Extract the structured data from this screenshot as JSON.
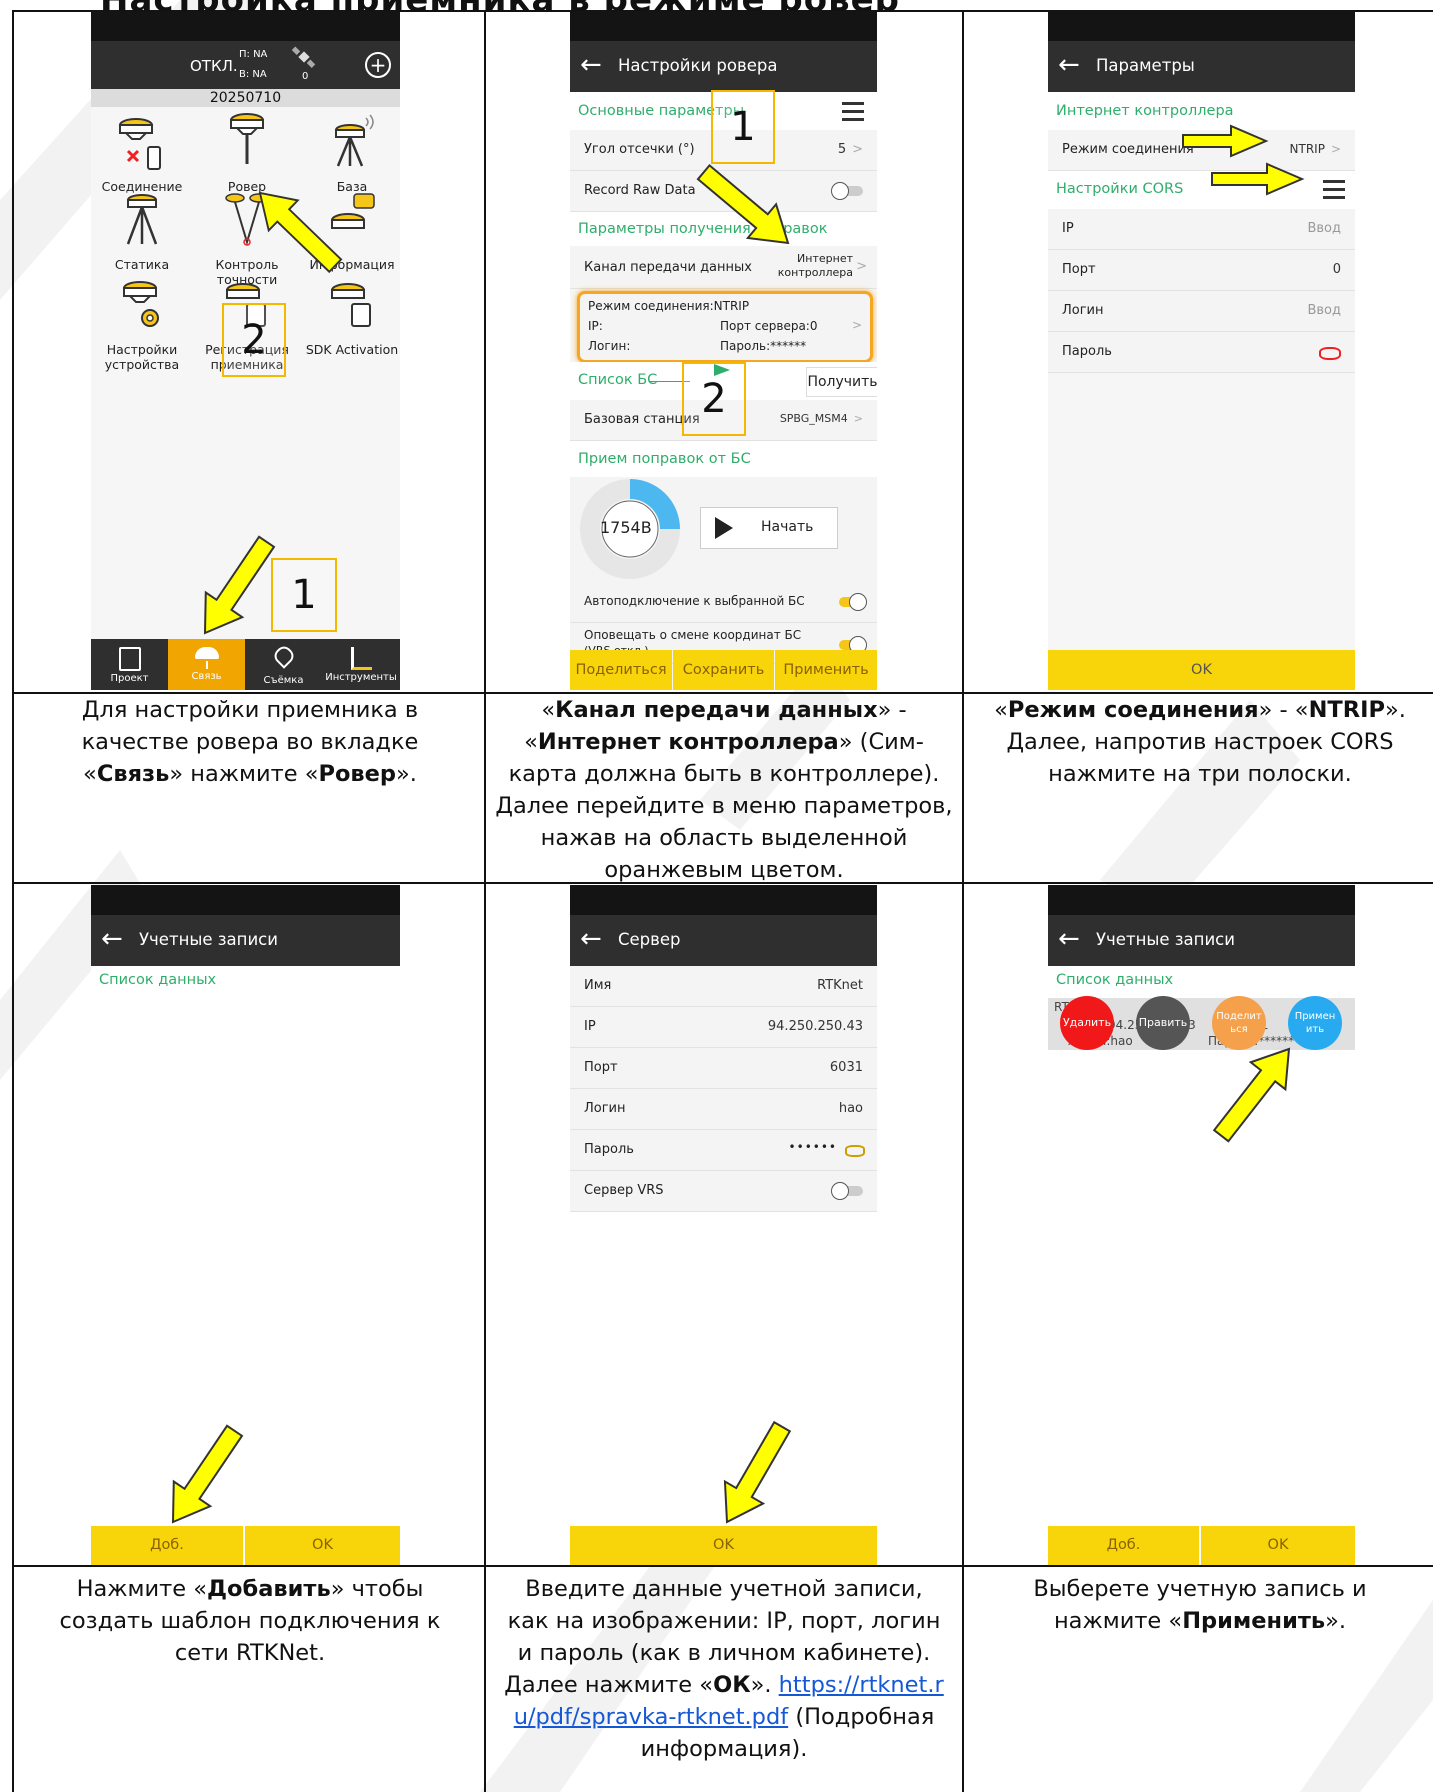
{
  "title": "Настройка приемника в режиме ровер",
  "colors": {
    "yellow": "#f8d40a",
    "green": "#2fae6b",
    "orange": "#f5a623",
    "appbar": "#2f2f2f",
    "link": "#1558d6"
  },
  "p1": {
    "status_label": "ОТКЛ.",
    "status_p": "П: NA",
    "status_b": "В: NA",
    "sat_count": "0",
    "date": "20250710",
    "tiles": [
      "Соединение",
      "Ровер",
      "База",
      "Статика",
      "Контроль точности",
      "Информация",
      "Настройки устройства",
      "Регистрация приемника",
      "SDK Activation"
    ],
    "nav": [
      "Проект",
      "Связь",
      "Съёмка",
      "Инструменты"
    ],
    "marker1": "1",
    "marker2": "2"
  },
  "p2": {
    "title": "Настройки ровера",
    "sect_basic": "Основные параметры",
    "cutoff_label": "Угол отсечки (°)",
    "cutoff_value": "5",
    "raw_label": "Record Raw Data",
    "sect_corr": "Параметры получения поправок",
    "channel_label": "Канал передачи данных",
    "channel_value": "Интернет контроллера",
    "mode_line": "Режим соединения:NTRIP",
    "ip_label": "IP:",
    "port_label": "Порт сервера:0",
    "login_label": "Логин:",
    "password_label": "Пароль:******",
    "bs_list": "Список БС",
    "get_button": "Получить",
    "base_label": "Базовая станция",
    "base_value": "SPBG_MSM4",
    "sect_recv": "Прием поправок от БС",
    "bytes": "1754B",
    "start_button": "Начать",
    "autoconnect": "Автоподключение к выбранной БС",
    "notify": "Оповещать о смене координат БС",
    "notify_sub": "(VRS откл.)",
    "share": "Поделиться",
    "save": "Сохранить",
    "apply": "Применить",
    "marker1": "1",
    "marker2": "2"
  },
  "p3": {
    "title": "Параметры",
    "sect_inet": "Интернет контроллера",
    "mode_label": "Режим соединения",
    "mode_value": "NTRIP",
    "sect_cors": "Настройки CORS",
    "ip_label": "IP",
    "ip_value": "Ввод",
    "port_label": "Порт",
    "port_value": "0",
    "login_label": "Логин",
    "login_value": "Ввод",
    "password_label": "Пароль",
    "ok": "OK"
  },
  "p4": {
    "title": "Учетные записи",
    "sect": "Список данных",
    "add": "Доб.",
    "ok": "OK"
  },
  "p5": {
    "title": "Сервер",
    "name_label": "Имя",
    "name_value": "RTKnet",
    "ip_label": "IP",
    "ip_value": "94.250.250.43",
    "port_label": "Порт",
    "port_value": "6031",
    "login_label": "Логин",
    "login_value": "hao",
    "password_label": "Пароль",
    "password_value": "••••••",
    "vrs_label": "Сервер VRS",
    "ok": "OK"
  },
  "p6": {
    "title": "Учетные записи",
    "sect": "Список данных",
    "item_name": "RTKnet",
    "item_ip": "94.250.250.43",
    "item_port": "6031",
    "item_login": "Логин:hao",
    "item_password": "Пароль:******",
    "btn_delete": "Удалить",
    "btn_edit": "Править",
    "btn_share": "Поделиться",
    "btn_apply": "Применить",
    "add": "Доб.",
    "ok": "OK"
  },
  "captions": {
    "c1_a": "Для настройки приемника в качестве ровера во вкладке «",
    "c1_b": "Связь",
    "c1_c": "» нажмите «",
    "c1_d": "Ровер",
    "c1_e": "».",
    "c2_a": "«",
    "c2_b": "Канал передачи данных",
    "c2_c": "» - «",
    "c2_d": "Интернет контроллера",
    "c2_e": "» (Сим-карта должна быть в контроллере). Далее перейдите в меню параметров, нажав на область выделенной оранжевым цветом.",
    "c3_a": "«",
    "c3_b": "Режим соединения",
    "c3_c": "» - «",
    "c3_d": "NTRIP",
    "c3_e": "». Далее, напротив настроек CORS нажмите на три полоски.",
    "c4_a": "Нажмите «",
    "c4_b": "Добавить",
    "c4_c": "» чтобы создать шаблон подключения к сети RTKNet.",
    "c5_a": "Введите данные учетной записи, как на изображении: IP, порт, логин и пароль (как в личном кабинете). Далее нажмите «",
    "c5_b": "ОК",
    "c5_c": "». ",
    "c5_link": "https://rtknet.ru/pdf/spravka-rtknet.pdf",
    "c5_d": " (Подробная информация).",
    "c6_a": "Выберете учетную запись и нажмите «",
    "c6_b": "Применить",
    "c6_c": "»."
  }
}
